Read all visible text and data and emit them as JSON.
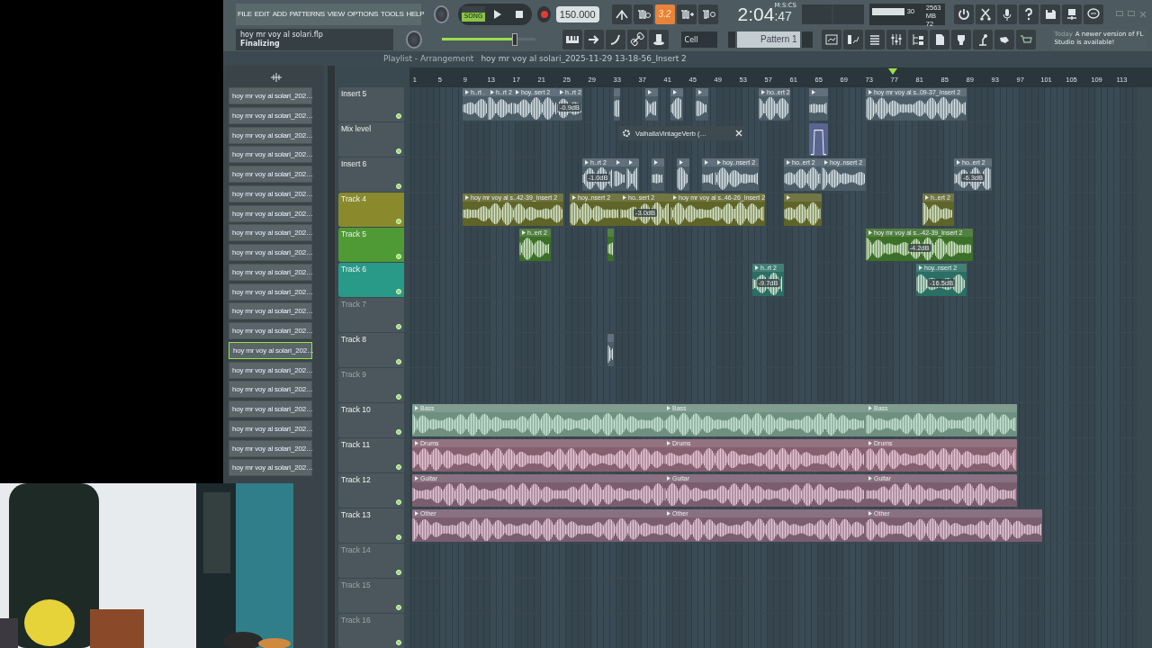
{
  "menu": [
    "FILE",
    "EDIT",
    "ADD",
    "PATTERNS",
    "VIEW",
    "OPTIONS",
    "TOOLS",
    "HELP"
  ],
  "hint": {
    "title": "hoy mr voy al solari.flp",
    "status": "Finalizing"
  },
  "transport": {
    "mode": "SONG",
    "song_selected": true,
    "tempo": "150.000",
    "master_volume": {
      "level": 0.78
    }
  },
  "step_button": {
    "label": "3.2",
    "on": true
  },
  "clock": {
    "time": "2:04",
    "sub": ":47",
    "unit": "M:S:CS"
  },
  "monitor": {
    "cpu": "30",
    "memory": "2563 MB",
    "polyphony": "72"
  },
  "snap": "Cell",
  "pattern": "Pattern 1",
  "news": {
    "day": "Today",
    "text": "A newer version of FL Studio is available!"
  },
  "playlist": {
    "title": "Playlist - Arrangement",
    "path": "hoy mr voy al solari_2025-11-29 13-18-56_Insert 2",
    "ruler": [
      "1",
      "5",
      "9",
      "13",
      "17",
      "21",
      "25",
      "29",
      "33",
      "37",
      "41",
      "45",
      "49",
      "53",
      "57",
      "61",
      "65",
      "69",
      "73",
      "77",
      "81",
      "85",
      "89",
      "93",
      "97",
      "101",
      "105",
      "109",
      "113"
    ]
  },
  "plugin_window": {
    "title": "ValhallaVintageVerb (…"
  },
  "browser": {
    "items": [
      {
        "label": "hoy mr voy al solari_202…",
        "selected": false
      },
      {
        "label": "hoy mr voy al solari_202…",
        "selected": false
      },
      {
        "label": "hoy mr voy al solari_202…",
        "selected": false
      },
      {
        "label": "hoy mr voy al solari_202…",
        "selected": false
      },
      {
        "label": "hoy mr voy al solari_202…",
        "selected": false
      },
      {
        "label": "hoy mr voy al solari_202…",
        "selected": false
      },
      {
        "label": "hoy mr voy al solari_202…",
        "selected": false
      },
      {
        "label": "hoy mr voy al solari_202…",
        "selected": false
      },
      {
        "label": "hoy mr voy al solari_202…",
        "selected": false
      },
      {
        "label": "hoy mr voy al solari_202…",
        "selected": false
      },
      {
        "label": "hoy mr voy al solari_202…",
        "selected": false
      },
      {
        "label": "hoy mr voy al solari_202…",
        "selected": false
      },
      {
        "label": "hoy mr voy al solari_202…",
        "selected": false
      },
      {
        "label": "hoy mr voy al solari_202…",
        "selected": true
      },
      {
        "label": "hoy mr voy al solari_202…",
        "selected": false
      },
      {
        "label": "hoy mr voy al solari_202…",
        "selected": false
      },
      {
        "label": "hoy mr voy al solari_202…",
        "selected": false
      },
      {
        "label": "hoy mr voy al solari_202…",
        "selected": false
      },
      {
        "label": "hoy mr voy al solari_202…",
        "selected": false
      },
      {
        "label": "hoy mr voy al solari_202…",
        "selected": false
      }
    ]
  },
  "tracks": [
    {
      "name": "Insert 5",
      "kind": "insert",
      "dimmed": false,
      "clips": [
        {
          "kind": "audio",
          "label": "h..rt ."
        },
        {
          "kind": "audio",
          "label": "h..rt 2"
        },
        {
          "kind": "audio",
          "label": "hoy..sert 2"
        },
        {
          "kind": "audio",
          "label": "h..rt 2",
          "gain": "-0.9dB"
        },
        {
          "kind": "audio"
        },
        {
          "kind": "audio"
        },
        {
          "kind": "audio"
        },
        {
          "kind": "audio"
        },
        {
          "kind": "audio",
          "label": "ho..ert 2"
        },
        {
          "kind": "audio"
        },
        {
          "kind": "audio",
          "label": "hoy mr voy al s..09-37_Insert 2"
        }
      ]
    },
    {
      "name": "Mix level",
      "kind": "automation",
      "dimmed": false,
      "clips": [
        {
          "kind": "automation"
        }
      ]
    },
    {
      "name": "Insert 6",
      "kind": "insert",
      "dimmed": false,
      "clips": [
        {
          "kind": "audio",
          "label": "h..rt 2",
          "gain": "-1.0dB"
        },
        {
          "kind": "audio"
        },
        {
          "kind": "audio"
        },
        {
          "kind": "audio"
        },
        {
          "kind": "audio"
        },
        {
          "kind": "audio"
        },
        {
          "kind": "audio",
          "label": "hoy..nsert 2"
        },
        {
          "kind": "audio",
          "label": "ho..ert 2"
        },
        {
          "kind": "audio",
          "label": "hoy..nsert 2"
        },
        {
          "kind": "audio",
          "label": "ho..ert 2",
          "gain": "-6.3dB"
        }
      ]
    },
    {
      "name": "Track 4",
      "kind": "track",
      "dimmed": false,
      "color": "#8a8a2c",
      "clips": [
        {
          "kind": "audio",
          "label": "hoy mr voy al s..42-39_Insert 2"
        },
        {
          "kind": "audio",
          "label": "hoy..nsert 2"
        },
        {
          "kind": "audio",
          "label": "ho..sert 2",
          "gain": "-3.0dB"
        },
        {
          "kind": "audio",
          "label": "hoy mr voy al s..46-26_Insert 2"
        },
        {
          "kind": "audio"
        },
        {
          "kind": "audio",
          "label": "h..ert 2"
        }
      ]
    },
    {
      "name": "Track 5",
      "kind": "track",
      "dimmed": false,
      "color": "#4f9a34",
      "clips": [
        {
          "kind": "audio",
          "label": "h..ert 2"
        },
        {
          "kind": "audio"
        },
        {
          "kind": "audio",
          "label": "hoy mr voy al s..-42-39_Insert 2",
          "gain": "-4.2dB"
        }
      ]
    },
    {
      "name": "Track 6",
      "kind": "track",
      "dimmed": false,
      "color": "#2a9a88",
      "clips": [
        {
          "kind": "audio",
          "label": "h..rt 2",
          "gain": "-9.7dB"
        },
        {
          "kind": "audio",
          "label": "hoy..nsert 2",
          "gain": "-16.5dB"
        }
      ]
    },
    {
      "name": "Track 7",
      "kind": "track",
      "dimmed": true
    },
    {
      "name": "Track 8",
      "kind": "track",
      "dimmed": false,
      "clips": [
        {
          "kind": "audio"
        }
      ]
    },
    {
      "name": "Track 9",
      "kind": "track",
      "dimmed": true
    },
    {
      "name": "Track 10",
      "kind": "track",
      "dimmed": false,
      "clips": [
        {
          "kind": "audio",
          "label": "Bass"
        },
        {
          "kind": "audio",
          "label": "Bass"
        },
        {
          "kind": "audio",
          "label": "Bass"
        }
      ]
    },
    {
      "name": "Track 11",
      "kind": "track",
      "dimmed": false,
      "clips": [
        {
          "kind": "audio",
          "label": "Drums"
        },
        {
          "kind": "audio",
          "label": "Drums"
        },
        {
          "kind": "audio",
          "label": "Drums"
        }
      ]
    },
    {
      "name": "Track 12",
      "kind": "track",
      "dimmed": false,
      "clips": [
        {
          "kind": "audio",
          "label": "Guitar"
        },
        {
          "kind": "audio",
          "label": "Guitar"
        },
        {
          "kind": "audio",
          "label": "Guitar"
        }
      ]
    },
    {
      "name": "Track 13",
      "kind": "track",
      "dimmed": false,
      "clips": [
        {
          "kind": "audio",
          "label": "Other"
        },
        {
          "kind": "audio",
          "label": "Other"
        },
        {
          "kind": "audio",
          "label": "Other"
        }
      ]
    },
    {
      "name": "Track 14",
      "kind": "track",
      "dimmed": true
    },
    {
      "name": "Track 15",
      "kind": "track",
      "dimmed": true
    },
    {
      "name": "Track 16",
      "kind": "track",
      "dimmed": true
    }
  ]
}
